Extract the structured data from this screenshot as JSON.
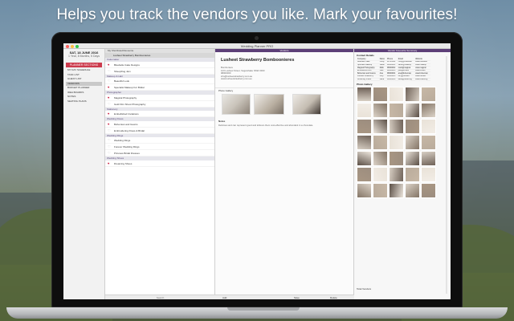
{
  "headline": "Helps you track the vendors you like. Mark your favourites!",
  "window": {
    "title": "Wedding Planner PRO"
  },
  "sidebar": {
    "date": "SAT, 18 JUNE 2016",
    "countdown": "1 Year, 8 Months, 5 Days",
    "active_button": "PLANNER SECTIONS",
    "items": [
      "MY DAY SCHEDULE",
      "TASK LIST",
      "GUEST LIST",
      "VENDORS",
      "BUDGET PLANNER",
      "IDEA BOARDS",
      "NOTES",
      "SEATING PLANS"
    ],
    "selected_index": 3
  },
  "list": {
    "header": "My Shortlisted/Favourite",
    "selected_item": "Lusheet Strawberry Bomboonieres",
    "categories": [
      {
        "name": "Cakemaker",
        "vendors": [
          {
            "name": "Bluebelle Cake Designs",
            "fav": true
          },
          {
            "name": "SheepDog Jam",
            "fav": false
          }
        ]
      },
      {
        "name": "Makeup & Hair",
        "vendors": [
          {
            "name": "Beautiful Look",
            "fav": false
          },
          {
            "name": "Specialst Makeup For Bridal",
            "fav": true
          }
        ]
      },
      {
        "name": "Photographer",
        "vendors": [
          {
            "name": "Magical Photography",
            "fav": true
          },
          {
            "name": "Gold Film Shoot Photography",
            "fav": false
          }
        ]
      },
      {
        "name": "Stationery",
        "vendors": [
          {
            "name": "Embellished Invitations",
            "fav": true
          }
        ]
      },
      {
        "name": "Wedding Dress",
        "vendors": [
          {
            "name": "Bohemian and Gowns",
            "fav": true
          },
          {
            "name": "Embroidering Dress & Bridal",
            "fav": false
          }
        ]
      },
      {
        "name": "Wedding Rings",
        "vendors": [
          {
            "name": "Wedding Rings",
            "fav": false
          },
          {
            "name": "Forever Wedding Rings",
            "fav": false
          },
          {
            "name": "Princess Bridal Dresses",
            "fav": false
          }
        ]
      },
      {
        "name": "Wedding Shoes",
        "vendors": [
          {
            "name": "Dreaming Shoes",
            "fav": true
          }
        ]
      }
    ],
    "footer": "Search"
  },
  "detail": {
    "header": "Vendors",
    "title": "Lusheet Strawberry Bomboonieres",
    "type_label": "Bomboniere",
    "address": "123 Lusheet Street, Sugarshake NSW 2000",
    "phone": "98000000",
    "email": "info@lusheetstrawberry.com.au",
    "website": "www.lusheetstrawberry.com.au",
    "photo_gallery_label": "Photo Gallery",
    "notes_label": "Notes",
    "notes_text": "Delicious and can represent good and leftover-them cost-effective and abundant in a chocolate.",
    "footer": {
      "left": "Add",
      "right": "Save",
      "delete": "Delete"
    }
  },
  "right": {
    "header": "Vendor Favourite Summary",
    "contact_details_label": "Contact Details",
    "columns": [
      "Company",
      "Name",
      "Phone",
      "Email",
      "Website"
    ],
    "rows": [
      [
        "Bluebelle Cake",
        "Cindy",
        "98765432",
        "cindy@bluebelle",
        "www.bluebelle"
      ],
      [
        "Specialst Makeup",
        "Sarah",
        "98000001",
        "sarah@makeup",
        "www.makeup"
      ],
      [
        "Magical Photography",
        "Mark",
        "98000002",
        "mark@magical",
        "www.magical"
      ],
      [
        "Embellished Invit",
        "Julie",
        "98000003",
        "julie@embell",
        "www.embell"
      ],
      [
        "Bohemian and Gowns",
        "Ana",
        "98000004",
        "ana@bohemian",
        "www.bohemian"
      ],
      [
        "Lusheet Strawberry",
        "Lucy",
        "98000005",
        "lucy@lusheet",
        "www.lusheet"
      ],
      [
        "Dreaming Shoes",
        "Dana",
        "98000006",
        "dana@dreaming",
        "www.dreaming"
      ]
    ],
    "photo_gallery_label": "Photo Gallery",
    "total_label": "Total Vendors"
  },
  "colors": {
    "accent": "#5d3f78",
    "planner_button": "#cc3b4d",
    "heart": "#cc2244"
  }
}
